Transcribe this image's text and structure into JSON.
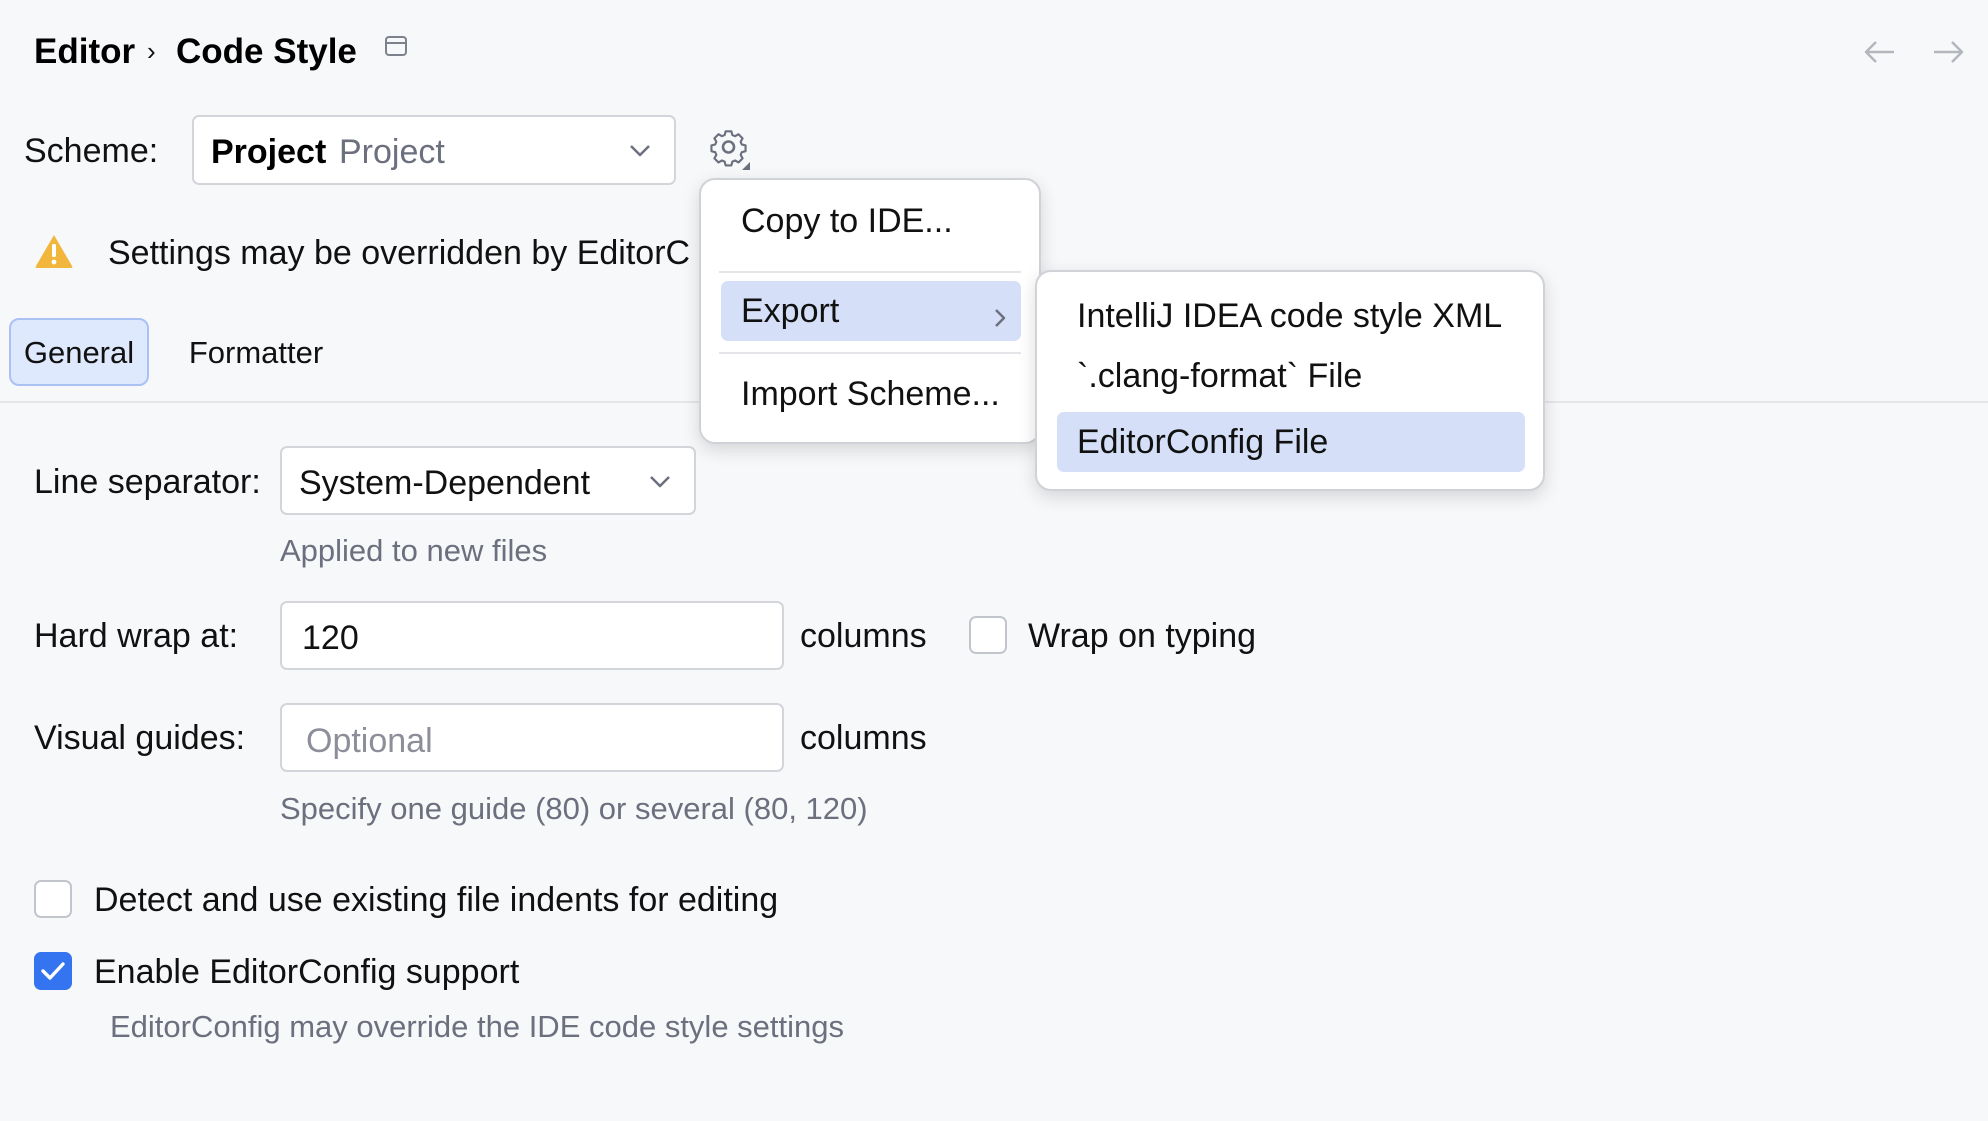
{
  "breadcrumb": {
    "parent": "Editor",
    "separator": "›",
    "current": "Code Style"
  },
  "scheme": {
    "label": "Scheme:",
    "selected_name": "Project",
    "selected_kind": "Project"
  },
  "warning": {
    "text": "Settings may be overridden by EditorC"
  },
  "tabs": [
    {
      "label": "General",
      "active": true
    },
    {
      "label": "Formatter",
      "active": false
    }
  ],
  "line_separator": {
    "label": "Line separator:",
    "value": "System-Dependent",
    "hint": "Applied to new files"
  },
  "hard_wrap": {
    "label": "Hard wrap at:",
    "value": "120",
    "unit": "columns",
    "wrap_on_typing_label": "Wrap on typing",
    "wrap_on_typing_checked": false
  },
  "visual_guides": {
    "label": "Visual guides:",
    "placeholder": "Optional",
    "unit": "columns",
    "hint": "Specify one guide (80) or several (80, 120)"
  },
  "detect_indents": {
    "label": "Detect and use existing file indents for editing",
    "checked": false
  },
  "editorconfig": {
    "label": "Enable EditorConfig support",
    "checked": true,
    "hint": "EditorConfig may override the IDE code style settings"
  },
  "scheme_menu": {
    "items": [
      "Copy to IDE...",
      "Export",
      "Import Scheme..."
    ],
    "highlighted": "Export"
  },
  "export_submenu": {
    "items": [
      "IntelliJ IDEA code style XML",
      "`.clang-format` File",
      "EditorConfig File"
    ],
    "highlighted": "EditorConfig File"
  },
  "icons": {
    "window": "window-icon",
    "back": "back-arrow-icon",
    "forward": "forward-arrow-icon",
    "gear": "gear-icon",
    "warning": "warning-icon",
    "chevron": "chevron-down-icon",
    "submenu": "chevron-right-icon",
    "check": "checkmark-icon"
  },
  "colors": {
    "background": "#f7f8fa",
    "accent": "#3574f0",
    "highlight": "#d5e0f8",
    "tab_active_bg": "#dfe9fd",
    "warning": "#f2b63c",
    "hint_text": "#6c707e"
  }
}
